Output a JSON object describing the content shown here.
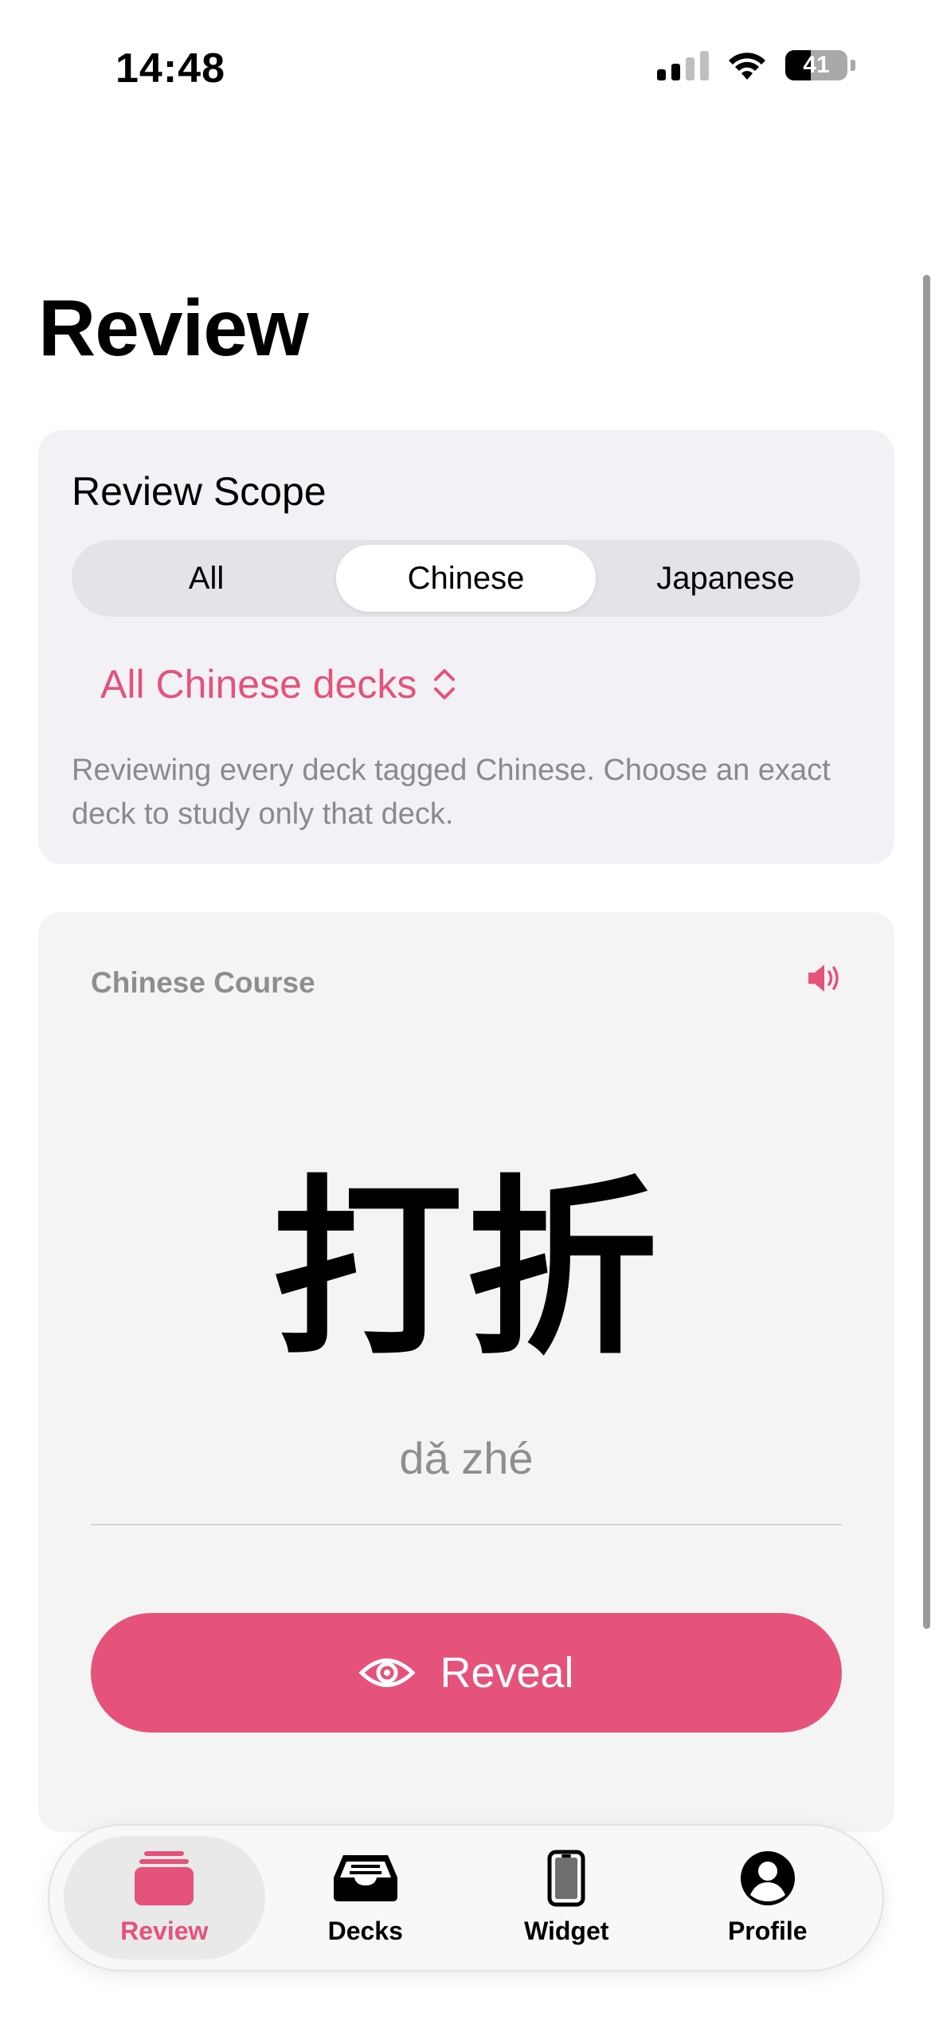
{
  "status_bar": {
    "time": "14:48",
    "battery": "41",
    "icons": [
      "signal-icon",
      "wifi-icon",
      "battery-icon"
    ]
  },
  "page": {
    "title": "Review"
  },
  "scope": {
    "title": "Review Scope",
    "segments": [
      "All",
      "Chinese",
      "Japanese"
    ],
    "selected_segment": "Chinese",
    "deck_picker_label": "All Chinese decks",
    "description": "Reviewing every deck tagged Chinese. Choose an exact deck to study only that deck."
  },
  "card": {
    "deck_name": "Chinese Course",
    "word": "打折",
    "pinyin": "dǎ zhé",
    "reveal_label": "Reveal"
  },
  "tab_bar": {
    "tabs": [
      {
        "label": "Review",
        "icon": "stack-icon"
      },
      {
        "label": "Decks",
        "icon": "tray-icon"
      },
      {
        "label": "Widget",
        "icon": "phone-icon"
      },
      {
        "label": "Profile",
        "icon": "person-icon"
      }
    ],
    "active": "Review"
  },
  "colors": {
    "accent": "#e5527a",
    "secondary_text": "#8a8a8e",
    "card_background": "#f2f2f6"
  }
}
